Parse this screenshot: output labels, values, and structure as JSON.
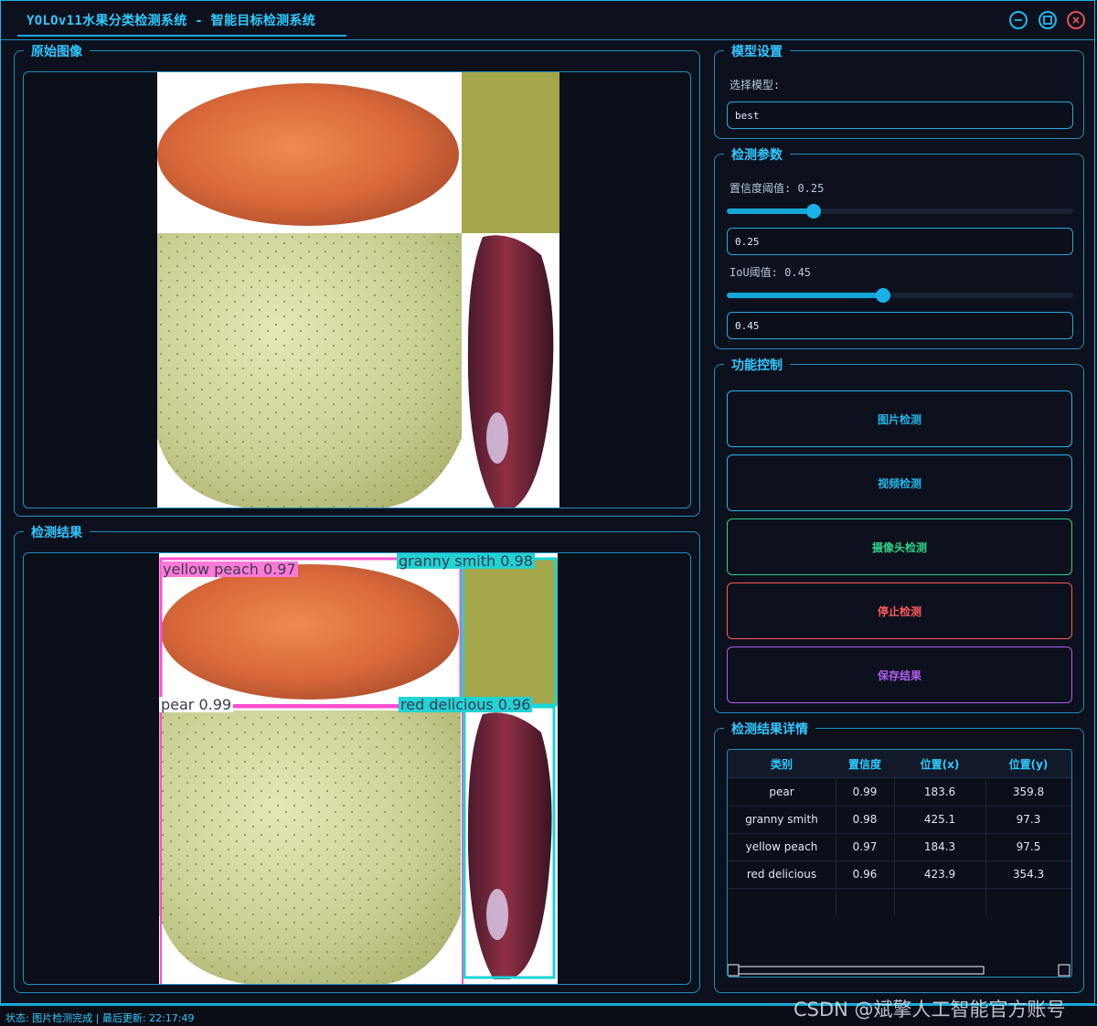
{
  "window": {
    "title": "YOLOv11水果分类检测系统 - 智能目标检测系统"
  },
  "panels": {
    "original_title": "原始图像",
    "result_title": "检测结果",
    "model_title": "模型设置",
    "params_title": "检测参数",
    "func_title": "功能控制",
    "details_title": "检测结果详情"
  },
  "model": {
    "select_label": "选择模型:",
    "selected": "best"
  },
  "params": {
    "conf_label": "置信度阈值: 0.25",
    "conf_value": "0.25",
    "conf_fraction": 0.25,
    "iou_label": "IoU阈值: 0.45",
    "iou_value": "0.45",
    "iou_fraction": 0.45
  },
  "buttons": {
    "image_detect": "图片检测",
    "video_detect": "视频检测",
    "camera_detect": "摄像头检测",
    "stop_detect": "停止检测",
    "save_result": "保存结果"
  },
  "colors": {
    "image_detect": "#22b7ea",
    "video_detect": "#22b7ea",
    "camera_detect": "#2fd08a",
    "stop_detect": "#ff5a5a",
    "save_result": "#b05cf0",
    "pink_box": "#ff4fd0",
    "cyan_box": "#18d6d6"
  },
  "table": {
    "headers": [
      "类别",
      "置信度",
      "位置(x)",
      "位置(y)"
    ],
    "rows": [
      [
        "pear",
        "0.99",
        "183.6",
        "359.8"
      ],
      [
        "granny smith",
        "0.98",
        "425.1",
        "97.3"
      ],
      [
        "yellow peach",
        "0.97",
        "184.3",
        "97.5"
      ],
      [
        "red delicious",
        "0.96",
        "423.9",
        "354.3"
      ]
    ]
  },
  "detections": {
    "yellow_peach": "yellow peach 0.97",
    "granny_smith": "granny smith 0.98",
    "pear": "pear 0.99",
    "red_delicious": "red delicious 0.96"
  },
  "status": {
    "text": "状态: 图片检测完成 | 最后更新: 22:17:49"
  },
  "watermark": "CSDN @斌擎人工智能官方账号"
}
